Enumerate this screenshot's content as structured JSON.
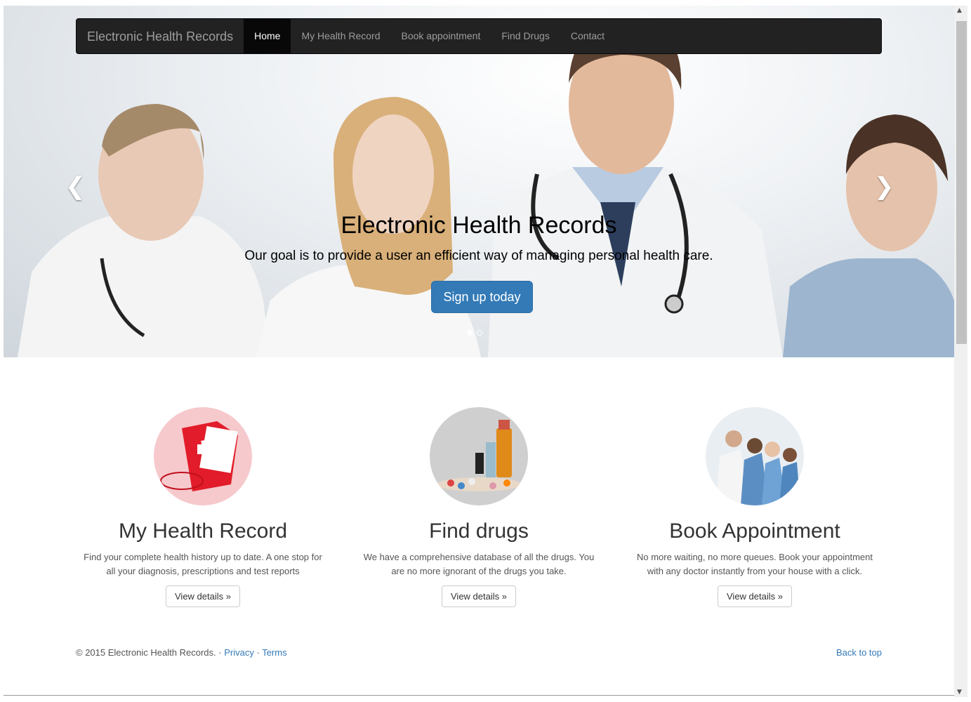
{
  "navbar": {
    "brand": "Electronic Health Records",
    "items": [
      {
        "label": "Home",
        "active": true
      },
      {
        "label": "My Health Record"
      },
      {
        "label": "Book appointment"
      },
      {
        "label": "Find Drugs"
      },
      {
        "label": "Contact"
      }
    ]
  },
  "carousel": {
    "title": "Electronic Health Records",
    "subtitle": "Our goal is to provide a user an efficient way of managing personal health care.",
    "button": "Sign up today",
    "prev_icon": "chevron-left-icon",
    "next_icon": "chevron-right-icon",
    "slide_count": 2,
    "active_slide": 1
  },
  "features": [
    {
      "title": "My Health Record",
      "text": "Find your complete health history up to date. A one stop for all your diagnosis, prescriptions and test reports",
      "button": "View details »",
      "image": "medical-folder-image"
    },
    {
      "title": "Find drugs",
      "text": "We have a comprehensive database of all the drugs. You are no more ignorant of the drugs you take.",
      "button": "View details »",
      "image": "medicine-bottles-image"
    },
    {
      "title": "Book Appointment",
      "text": "No more waiting, no more queues. Book your appointment with any doctor instantly from your house with a click.",
      "button": "View details »",
      "image": "doctors-team-image"
    }
  ],
  "footer": {
    "copyright": "© 2015 Electronic Health Records.",
    "sep": "·",
    "privacy": "Privacy",
    "terms": "Terms",
    "back_to_top": "Back to top"
  },
  "colors": {
    "primary": "#337ab7",
    "navbar": "#222222"
  }
}
